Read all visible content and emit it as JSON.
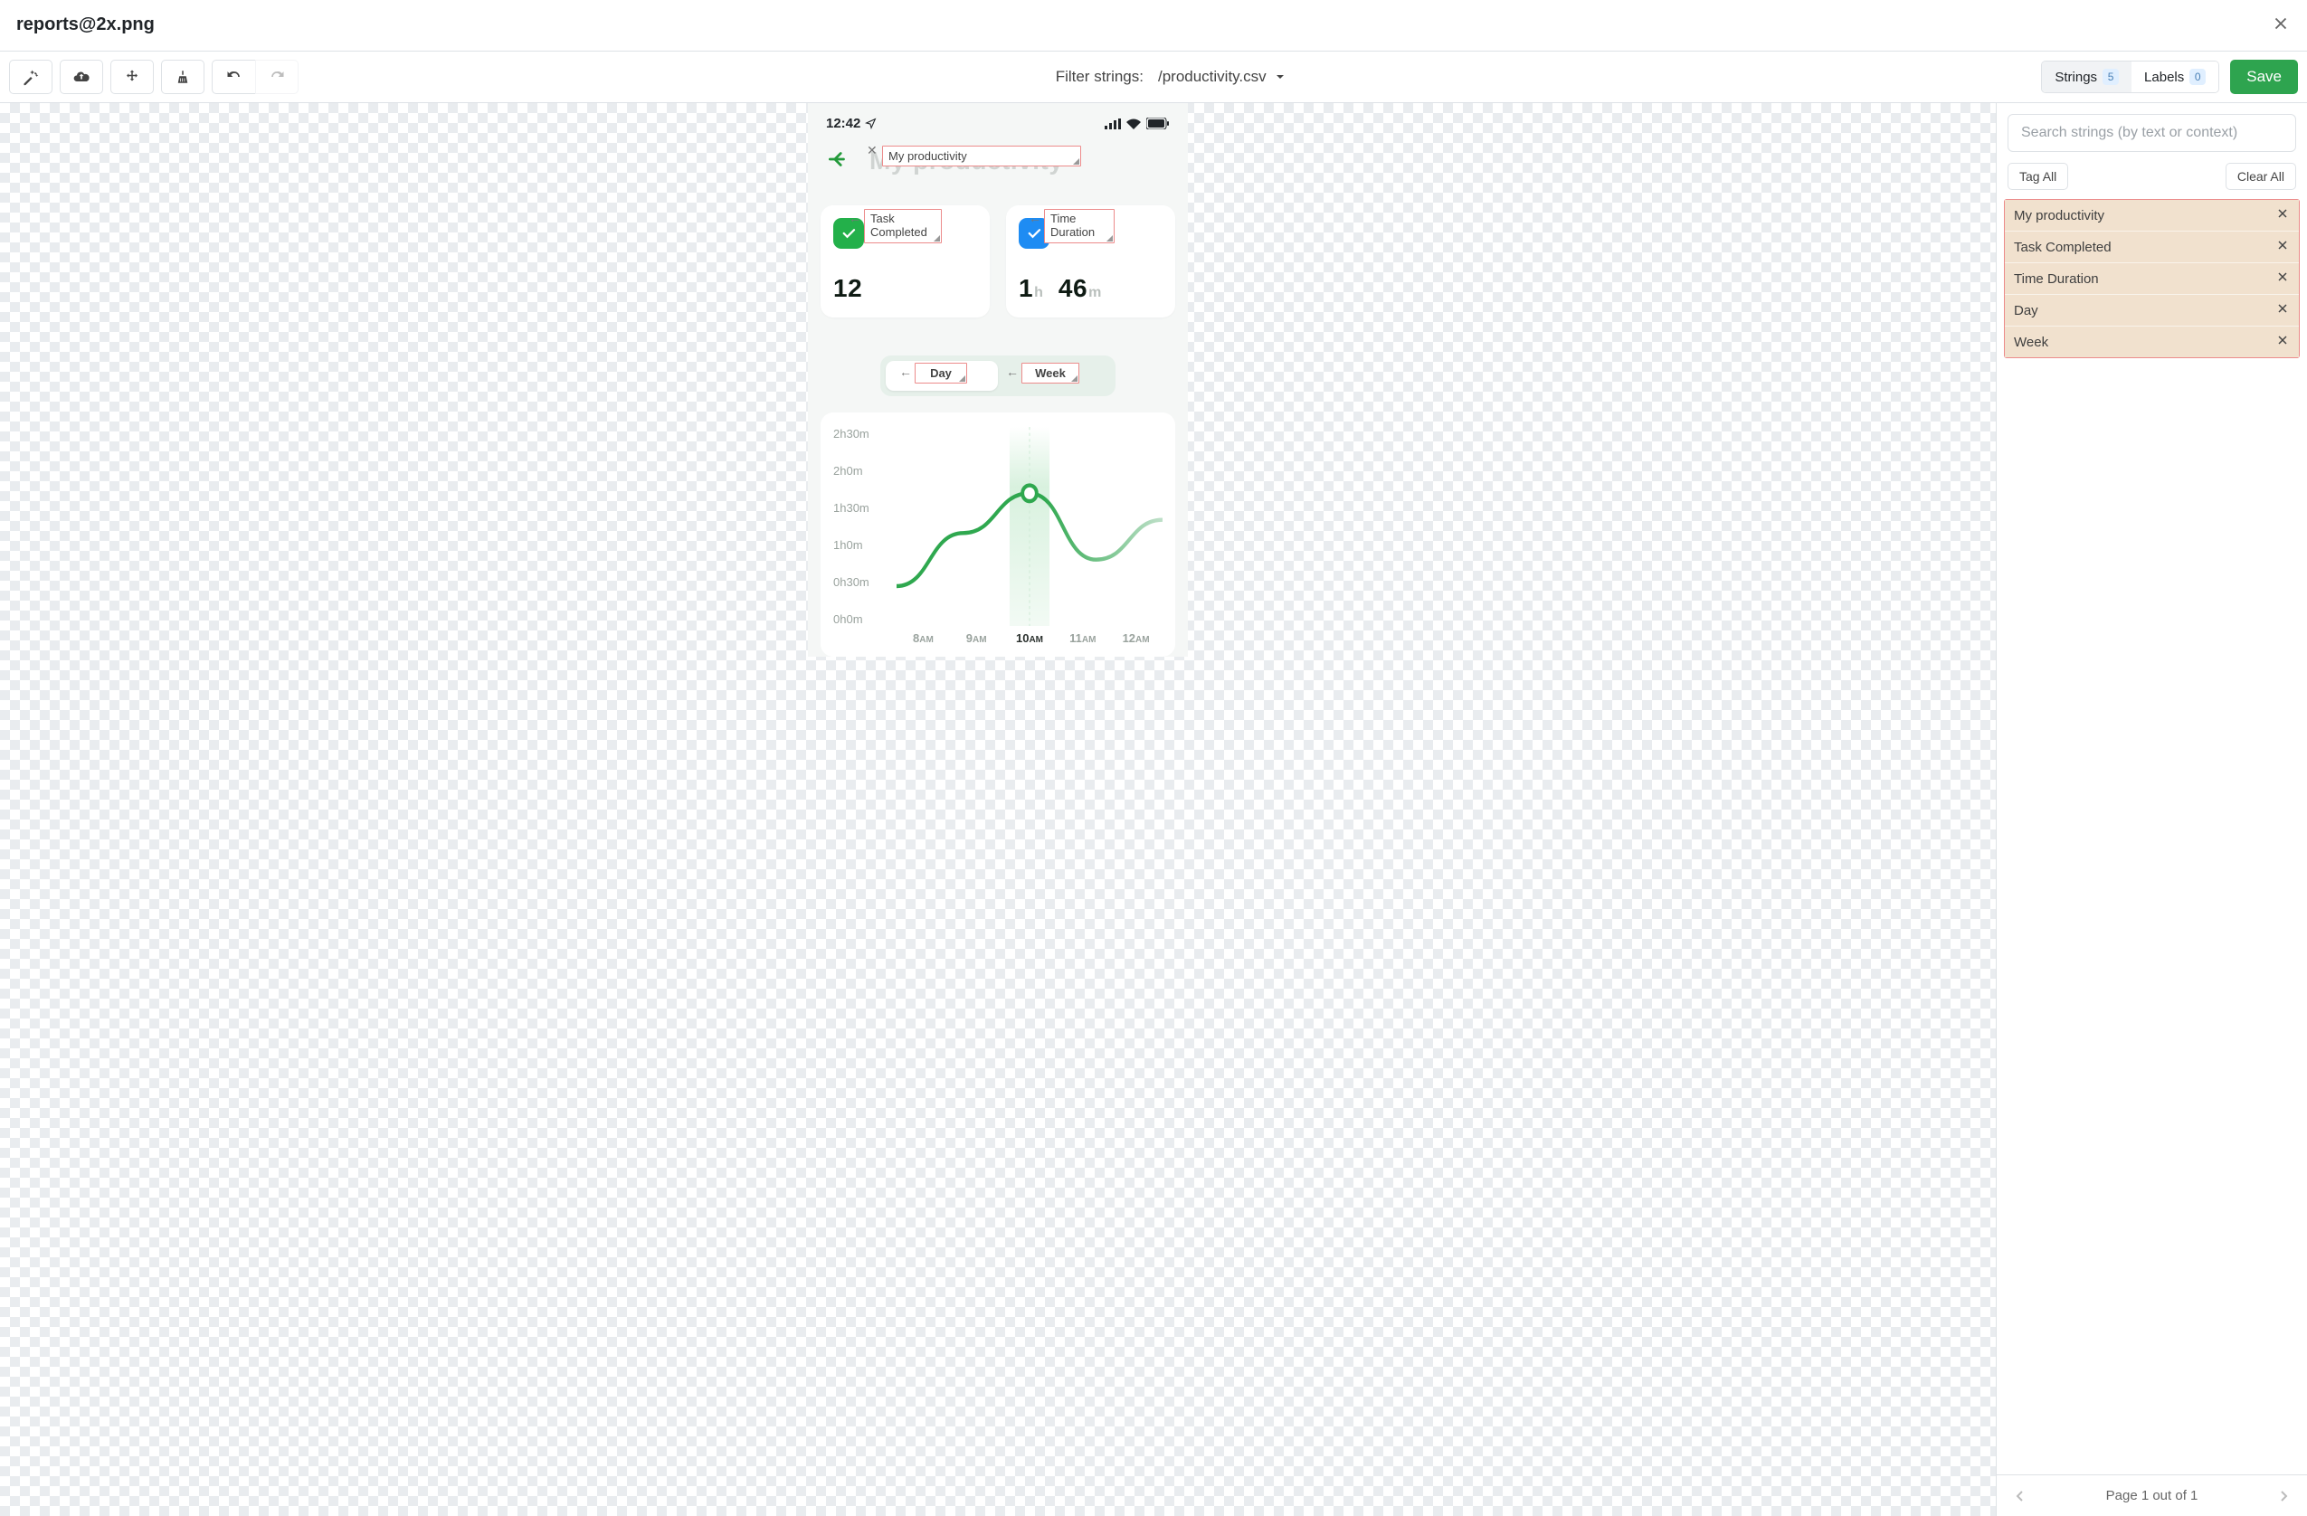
{
  "titlebar": {
    "filename": "reports@2x.png"
  },
  "toolbar": {
    "filter_label": "Filter strings:",
    "filter_value": "/productivity.csv",
    "strings_label": "Strings",
    "strings_count": "5",
    "labels_label": "Labels",
    "labels_count": "0",
    "save_label": "Save"
  },
  "sidebar": {
    "search_placeholder": "Search strings (by text or context)",
    "tag_all": "Tag All",
    "clear_all": "Clear All",
    "items": [
      {
        "text": "My productivity"
      },
      {
        "text": "Task Completed"
      },
      {
        "text": "Time Duration"
      },
      {
        "text": "Day"
      },
      {
        "text": "Week"
      }
    ],
    "pager": "Page 1 out of 1"
  },
  "device": {
    "status_time": "12:42",
    "ghost_title": "My productivity",
    "card1_ghost": "Completed",
    "card1_value": "12",
    "card2_ghost": "Duration",
    "card2_value_h": "1",
    "card2_value_m": "46",
    "tab_day_ghost": "Day",
    "tab_week_ghost": "Week"
  },
  "annotations": {
    "title": "My productivity",
    "task_line1": "Task",
    "task_line2": "Completed",
    "time_line1": "Time",
    "time_line2": "Duration",
    "day": "Day",
    "week": "Week"
  },
  "chart_data": {
    "type": "line",
    "title": "",
    "xlabel": "",
    "ylabel": "",
    "categories": [
      "8AM",
      "9AM",
      "10AM",
      "11AM",
      "12AM"
    ],
    "active_index": 2,
    "y_ticks": [
      "2h30m",
      "2h0m",
      "1h30m",
      "1h0m",
      "0h30m",
      "0h0m"
    ],
    "ylim_minutes": [
      0,
      150
    ],
    "values_minutes": [
      30,
      70,
      100,
      50,
      80
    ],
    "highlight_value_minutes": 100
  }
}
